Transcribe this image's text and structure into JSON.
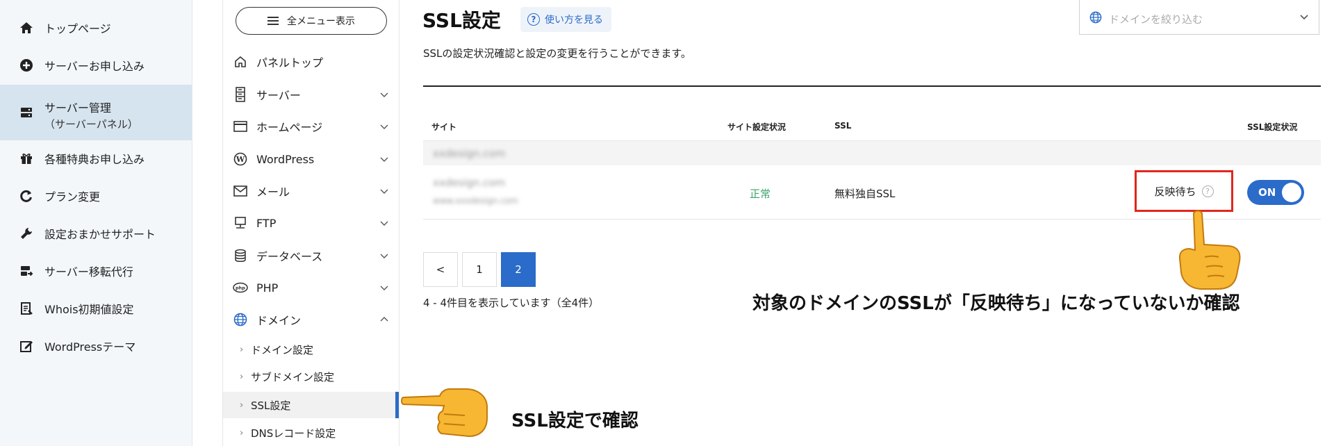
{
  "global_sidebar": {
    "items": [
      {
        "label": "トップページ",
        "icon": "home-icon"
      },
      {
        "label": "サーバーお申し込み",
        "icon": "plus-circle-icon"
      },
      {
        "label": "サーバー管理",
        "sublabel": "（サーバーパネル）",
        "icon": "server-icon",
        "active": true
      },
      {
        "label": "各種特典お申し込み",
        "icon": "gift-icon"
      },
      {
        "label": "プラン変更",
        "icon": "refresh-icon"
      },
      {
        "label": "設定おまかせサポート",
        "icon": "wrench-icon"
      },
      {
        "label": "サーバー移転代行",
        "icon": "server-move-icon"
      },
      {
        "label": "Whois初期値設定",
        "icon": "document-icon"
      },
      {
        "label": "WordPressテーマ",
        "icon": "edit-icon"
      }
    ]
  },
  "panel_sidebar": {
    "menu_button_label": "全メニュー表示",
    "items": [
      {
        "label": "パネルトップ",
        "icon": "home-outline-icon"
      },
      {
        "label": "サーバー",
        "icon": "server-stack-icon"
      },
      {
        "label": "ホームページ",
        "icon": "browser-window-icon"
      },
      {
        "label": "WordPress",
        "icon": "wordpress-icon"
      },
      {
        "label": "メール",
        "icon": "mail-icon"
      },
      {
        "label": "FTP",
        "icon": "monitor-icon"
      },
      {
        "label": "データベース",
        "icon": "database-icon"
      },
      {
        "label": "PHP",
        "icon": "php-icon"
      },
      {
        "label": "ドメイン",
        "icon": "globe-icon"
      }
    ],
    "domain_subitems": [
      {
        "label": "ドメイン設定"
      },
      {
        "label": "サブドメイン設定"
      },
      {
        "label": "SSL設定",
        "active": true
      },
      {
        "label": "DNSレコード設定"
      }
    ]
  },
  "main": {
    "title": "SSL設定",
    "help_label": "使い方を見る",
    "description": "SSLの設定状況確認と設定の変更を行うことができます。",
    "domain_filter_placeholder": "ドメインを絞り込む",
    "table": {
      "headers": {
        "site": "サイト",
        "site_status": "サイト設定状況",
        "ssl": "SSL",
        "ssl_status": "SSL設定状況"
      },
      "group_row_label": "xxdesign.com",
      "row": {
        "site_name": "xxdesign.com",
        "site_subtext": "www.xxxdesign.com",
        "site_status": "正常",
        "ssl_type": "無料独自SSL",
        "ssl_state": "反映待ち",
        "toggle_label": "ON"
      }
    },
    "pagination": {
      "prev_label": "<",
      "pages": [
        "1",
        "2"
      ],
      "current": "2",
      "result_text": "4 - 4件目を表示しています（全4件）"
    }
  },
  "annotations": {
    "pending_check": "対象のドメインのSSLが「反映待ち」になっていないか確認",
    "ssl_setting_check": "SSL設定で確認"
  },
  "colors": {
    "accent": "#2b6bc9",
    "highlight_box": "#e2261c",
    "status_ok": "#3aa56b",
    "sidebar_bg": "#f3f7fa",
    "sidebar_active_bg": "#d6e4ef"
  }
}
